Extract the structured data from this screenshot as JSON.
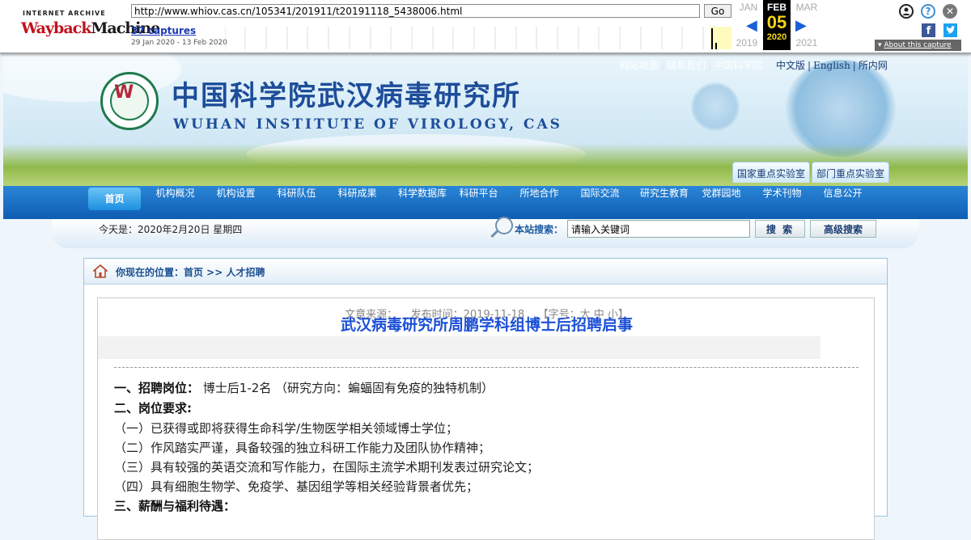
{
  "wayback": {
    "logo_line1": "INTERNET ARCHIVE",
    "logo_way": "Wayback",
    "logo_machine": "Machine",
    "url": "http://www.whiov.cas.cn/105341/201911/t20191118_5438006.html",
    "go_label": "Go",
    "captures": "37 captures",
    "range": "29 Jan 2020 - 13 Feb 2020",
    "prev_month": "JAN",
    "prev_year": "2019",
    "cur_month": "FEB",
    "cur_day": "05",
    "cur_year": "2020",
    "next_month": "MAR",
    "next_year": "2021",
    "about": "About this capture"
  },
  "header": {
    "top_links": [
      "网站地图",
      "联系我们",
      "中国科学院"
    ],
    "lang_links": [
      "中文版",
      "English",
      "所内网"
    ],
    "cn_title": "中国科学院武汉病毒研究所",
    "en_title": "WUHAN INSTITUTE OF VIROLOGY, CAS",
    "lab_tabs": [
      "国家重点实验室",
      "部门重点实验室"
    ]
  },
  "nav": [
    "首页",
    "机构概况",
    "机构设置",
    "科研队伍",
    "科研成果",
    "科学数据库",
    "科研平台",
    "所地合作",
    "国际交流",
    "研究生教育",
    "党群园地",
    "学术刊物",
    "信息公开"
  ],
  "strip": {
    "date": "今天是：2020年2月20日 星期四",
    "search_label": "本站搜索：",
    "search_value": "请输入关键词",
    "search_btn": "搜 索",
    "adv_btn": "高级搜索"
  },
  "crumb": "你现在的位置：首页 >> 人才招聘",
  "article": {
    "title": "武汉病毒研究所周鹏学科组博士后招聘启事",
    "meta": "文章来源：    发布时间：2019-11-18    【字号：大 中 小】",
    "h1_label": "一、招聘岗位：",
    "h1_text": " 博士后1-2名 （研究方向：蝙蝠固有免疫的独特机制）",
    "h2": "二、岗位要求:",
    "req": [
      "（一）已获得或即将获得生命科学/生物医学相关领域博士学位；",
      "（二）作风踏实严谨，具备较强的独立科研工作能力及团队协作精神；",
      "（三）具有较强的英语交流和写作能力，在国际主流学术期刊发表过研究论文；",
      "（四）具有细胞生物学、免疫学、基因组学等相关经验背景者优先；"
    ],
    "h3": "三、薪酬与福利待遇："
  }
}
